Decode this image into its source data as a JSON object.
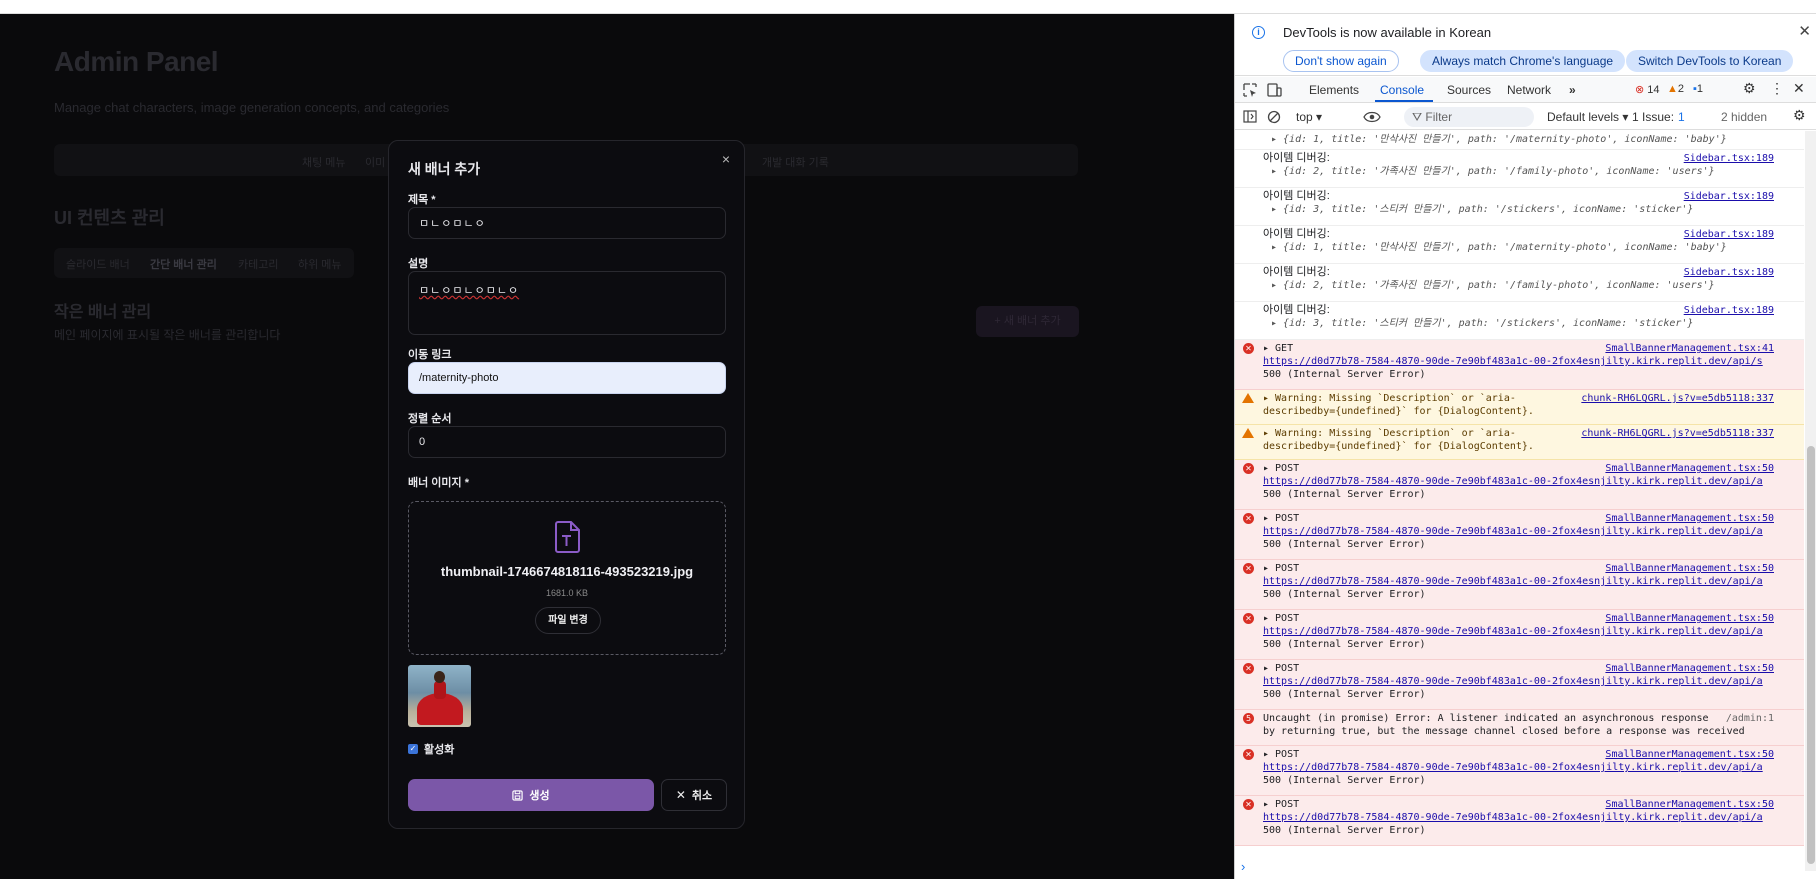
{
  "app": {
    "title": "Admin Panel",
    "subtitle": "Manage chat characters, image generation concepts, and categories",
    "nav": [
      "채팅 메뉴",
      "이미",
      "개발 대화 기록"
    ],
    "section_title": "UI 컨텐츠 관리",
    "tabs": [
      "슬라이드 배너",
      "간단 배너 관리",
      "카테고리",
      "하위 메뉴"
    ],
    "sub_section_title": "작은 배너 관리",
    "sub_section_desc": "메인 페이지에 표시될 작은 배너를 관리합니다",
    "add_button": "+ 새 배너 추가"
  },
  "modal": {
    "title": "새 배너 추가",
    "close_glyph": "×",
    "title_label": "제목 *",
    "title_value": "ㅁㄴㅇㅁㄴㅇ",
    "desc_label": "설명",
    "desc_value": "ㅁㄴㅇㅁㄴㅇㅁㄴㅇ",
    "link_label": "이동 링크",
    "link_value": "/maternity-photo",
    "order_label": "정렬 순서",
    "order_value": "0",
    "image_label": "배너 이미지 *",
    "file_name": "thumbnail-1746674818116-493523219.jpg",
    "file_size": "1681.0 KB",
    "change_file": "파일 변경",
    "active_label": "활성화",
    "active_checked": true,
    "create_button": "생성",
    "cancel_button": "취소",
    "accent": "#7b57a8"
  },
  "devtools": {
    "notice": "DevTools is now available in Korean",
    "notice_buttons": [
      "Don't show again",
      "Always match Chrome's language",
      "Switch DevTools to Korean"
    ],
    "tabs": [
      "Elements",
      "Console",
      "Sources",
      "Network"
    ],
    "active_tab": "Console",
    "counts": {
      "errors": "14",
      "warnings": "2",
      "info": "1"
    },
    "context": "top ▾",
    "filter_placeholder": "Filter",
    "levels": "Default levels ▾",
    "issues": "1 Issue:",
    "issues_count": "1",
    "hidden": "2 hidden",
    "logs": [
      {
        "kind": "obj",
        "label": "",
        "source": "",
        "obj": "▸ {id: 1, title: '만삭사진 만들기', path: '/maternity-photo', iconName: 'baby'}"
      },
      {
        "kind": "debug",
        "label": "아이템 디버깅:",
        "source": "Sidebar.tsx:189",
        "obj": "▸ {id: 2, title: '가족사진 만들기', path: '/family-photo', iconName: 'users'}"
      },
      {
        "kind": "debug",
        "label": "아이템 디버깅:",
        "source": "Sidebar.tsx:189",
        "obj": "▸ {id: 3, title: '스티커 만들기', path: '/stickers', iconName: 'sticker'}"
      },
      {
        "kind": "debug",
        "label": "아이템 디버깅:",
        "source": "Sidebar.tsx:189",
        "obj": "▸ {id: 1, title: '만삭사진 만들기', path: '/maternity-photo', iconName: 'baby'}"
      },
      {
        "kind": "debug",
        "label": "아이템 디버깅:",
        "source": "Sidebar.tsx:189",
        "obj": "▸ {id: 2, title: '가족사진 만들기', path: '/family-photo', iconName: 'users'}"
      },
      {
        "kind": "debug",
        "label": "아이템 디버깅:",
        "source": "Sidebar.tsx:189",
        "obj": "▸ {id: 3, title: '스티커 만들기', path: '/stickers', iconName: 'sticker'}"
      }
    ],
    "errors": [
      {
        "kind": "err",
        "method": "▸ GET",
        "source": "SmallBannerManagement.tsx:41",
        "url": "https://d0d77b78-7584-4870-90de-7e90bf483a1c-00-2fox4esnjilty.kirk.replit.dev/api/s",
        "status": "500 (Internal Server Error)"
      },
      {
        "kind": "warn",
        "method": "▸ Warning: Missing `Description` or `aria-",
        "source": "chunk-RH6LQGRL.js?v=e5db5118:337",
        "url": "",
        "status": "describedby={undefined}` for {DialogContent}."
      },
      {
        "kind": "warn",
        "method": "▸ Warning: Missing `Description` or `aria-",
        "source": "chunk-RH6LQGRL.js?v=e5db5118:337",
        "url": "",
        "status": "describedby={undefined}` for {DialogContent}."
      },
      {
        "kind": "err",
        "method": "▸ POST",
        "source": "SmallBannerManagement.tsx:50",
        "url": "https://d0d77b78-7584-4870-90de-7e90bf483a1c-00-2fox4esnjilty.kirk.replit.dev/api/a",
        "status": "500 (Internal Server Error)"
      },
      {
        "kind": "err",
        "method": "▸ POST",
        "source": "SmallBannerManagement.tsx:50",
        "url": "https://d0d77b78-7584-4870-90de-7e90bf483a1c-00-2fox4esnjilty.kirk.replit.dev/api/a",
        "status": "500 (Internal Server Error)"
      },
      {
        "kind": "err",
        "method": "▸ POST",
        "source": "SmallBannerManagement.tsx:50",
        "url": "https://d0d77b78-7584-4870-90de-7e90bf483a1c-00-2fox4esnjilty.kirk.replit.dev/api/a",
        "status": "500 (Internal Server Error)"
      },
      {
        "kind": "err",
        "method": "▸ POST",
        "source": "SmallBannerManagement.tsx:50",
        "url": "https://d0d77b78-7584-4870-90de-7e90bf483a1c-00-2fox4esnjilty.kirk.replit.dev/api/a",
        "status": "500 (Internal Server Error)"
      },
      {
        "kind": "err",
        "method": "▸ POST",
        "source": "SmallBannerManagement.tsx:50",
        "url": "https://d0d77b78-7584-4870-90de-7e90bf483a1c-00-2fox4esnjilty.kirk.replit.dev/api/a",
        "status": "500 (Internal Server Error)"
      },
      {
        "kind": "uncaught",
        "method": "Uncaught (in promise) Error: A listener indicated an asynchronous response",
        "source": "/admin:1",
        "url": "",
        "status": "by returning true, but the message channel closed before a response was received",
        "count": "5"
      },
      {
        "kind": "err",
        "method": "▸ POST",
        "source": "SmallBannerManagement.tsx:50",
        "url": "https://d0d77b78-7584-4870-90de-7e90bf483a1c-00-2fox4esnjilty.kirk.replit.dev/api/a",
        "status": "500 (Internal Server Error)"
      },
      {
        "kind": "err",
        "method": "▸ POST",
        "source": "SmallBannerManagement.tsx:50",
        "url": "https://d0d77b78-7584-4870-90de-7e90bf483a1c-00-2fox4esnjilty.kirk.replit.dev/api/a",
        "status": "500 (Internal Server Error)"
      }
    ],
    "prompt": "›"
  }
}
